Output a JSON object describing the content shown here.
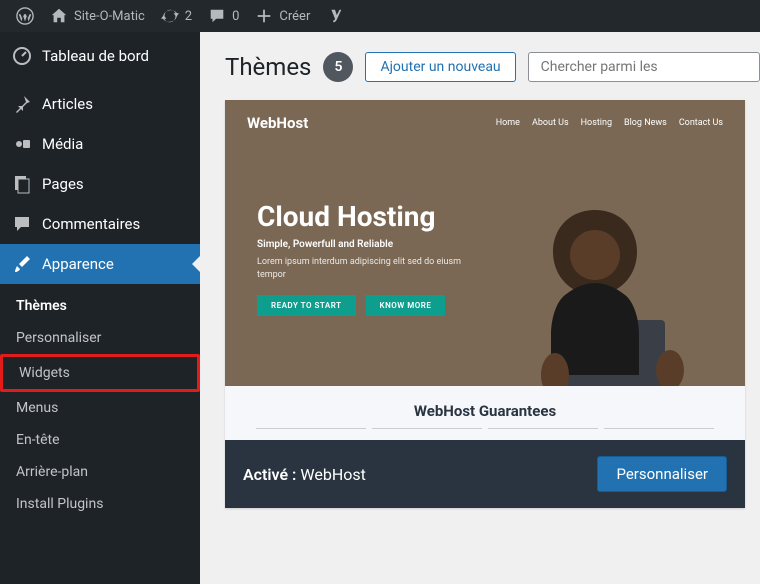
{
  "toolbar": {
    "site_name": "Site-O-Matic",
    "updates": "2",
    "comments": "0",
    "create": "Créer"
  },
  "sidebar": {
    "dashboard": "Tableau de bord",
    "posts": "Articles",
    "media": "Média",
    "pages": "Pages",
    "comments": "Commentaires",
    "appearance": "Apparence",
    "submenu": {
      "themes": "Thèmes",
      "customize": "Personnaliser",
      "widgets": "Widgets",
      "menus": "Menus",
      "header": "En-tête",
      "background": "Arrière-plan",
      "install_plugins": "Install Plugins"
    }
  },
  "header": {
    "title": "Thèmes",
    "count": "5",
    "add_new": "Ajouter un nouveau",
    "search_placeholder": "Chercher parmi les"
  },
  "theme": {
    "brand": "WebHost",
    "nav": {
      "home": "Home",
      "about": "About Us",
      "hosting": "Hosting",
      "blog": "Blog News",
      "contact": "Contact Us"
    },
    "hero_title": "Cloud Hosting",
    "hero_sub": "Simple, Powerfull and Reliable",
    "hero_lorem": "Lorem ipsum interdum adipiscing elit sed do eiusm tempor",
    "btn1": "READY TO START",
    "btn2": "KNOW MORE",
    "guarantee": "WebHost Guarantees",
    "active_label": "Activé :",
    "active_name": "WebHost",
    "customize": "Personnaliser"
  }
}
